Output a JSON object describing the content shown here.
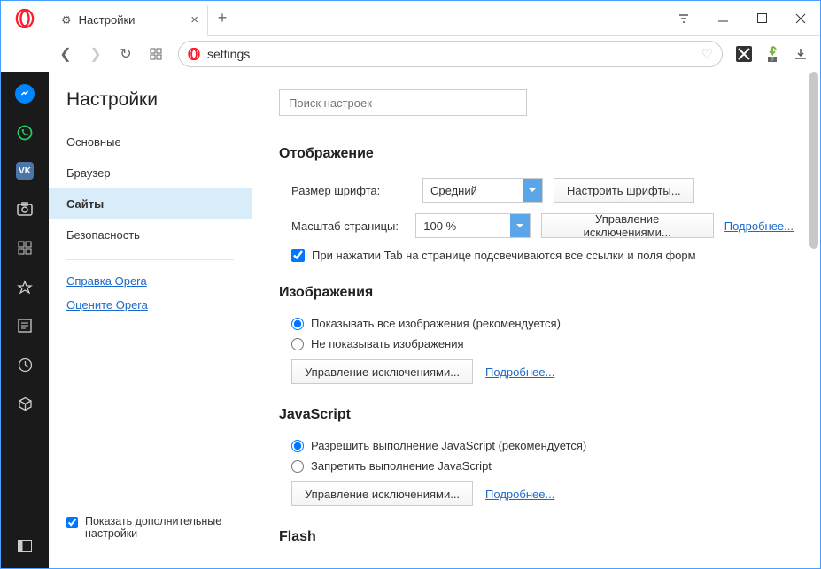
{
  "tab": {
    "title": "Настройки"
  },
  "address": {
    "value": "settings"
  },
  "sidebar": {
    "title": "Настройки",
    "items": [
      "Основные",
      "Браузер",
      "Сайты",
      "Безопасность"
    ],
    "links": [
      "Справка Opera",
      "Оцените Opera"
    ],
    "advanced": "Показать дополнительные настройки"
  },
  "search": {
    "placeholder": "Поиск настроек"
  },
  "display": {
    "heading": "Отображение",
    "font_label": "Размер шрифта:",
    "font_value": "Средний",
    "font_btn": "Настроить шрифты...",
    "zoom_label": "Масштаб страницы:",
    "zoom_value": "100 %",
    "zoom_btn": "Управление исключениями...",
    "zoom_link": "Подробнее...",
    "tab_check": "При нажатии Tab на странице подсвечиваются все ссылки и поля форм"
  },
  "images": {
    "heading": "Изображения",
    "opt1": "Показывать все изображения (рекомендуется)",
    "opt2": "Не показывать изображения",
    "btn": "Управление исключениями...",
    "link": "Подробнее..."
  },
  "js": {
    "heading": "JavaScript",
    "opt1": "Разрешить выполнение JavaScript (рекомендуется)",
    "opt2": "Запретить выполнение JavaScript",
    "btn": "Управление исключениями...",
    "link": "Подробнее..."
  },
  "flash": {
    "heading": "Flash"
  }
}
